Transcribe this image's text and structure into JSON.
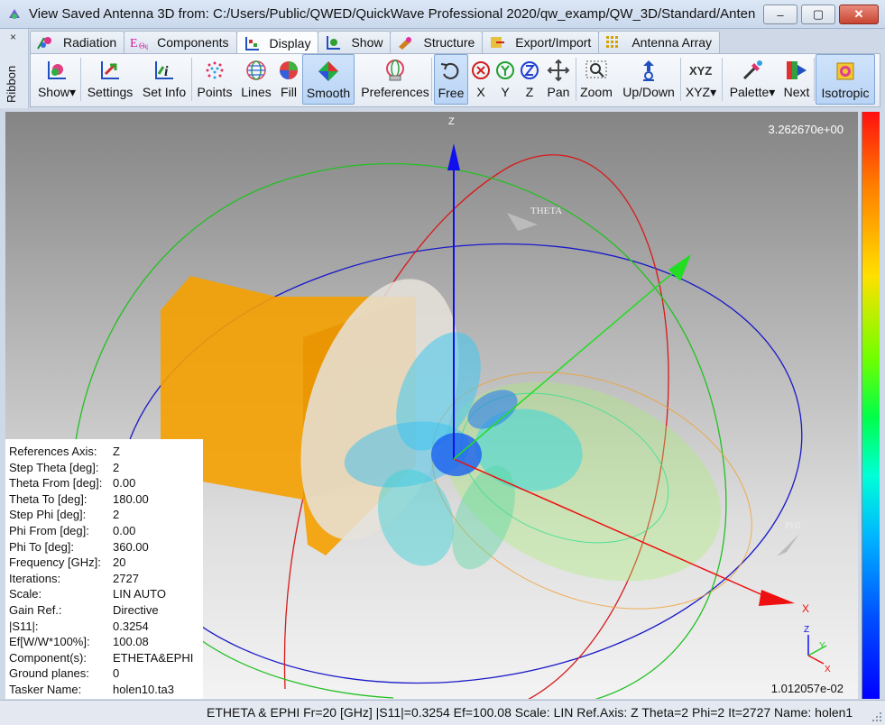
{
  "window": {
    "title": "View Saved Antenna 3D from: C:/Users/Public/QWED/QuickWave Professional 2020/qw_examp/QW_3D/Standard/Anten",
    "min_glyph": "–",
    "max_glyph": "▢",
    "close_glyph": "✕"
  },
  "sidestrip": {
    "close_glyph": "×",
    "label": "Ribbon"
  },
  "tabs": [
    {
      "label": "Radiation",
      "icon": "radiation-tab-icon"
    },
    {
      "label": "Components",
      "icon": "components-tab-icon"
    },
    {
      "label": "Display",
      "icon": "display-tab-icon",
      "active": true
    },
    {
      "label": "Show",
      "icon": "show-tab-icon"
    },
    {
      "label": "Structure",
      "icon": "structure-tab-icon"
    },
    {
      "label": "Export/Import",
      "icon": "export-import-tab-icon"
    },
    {
      "label": "Antenna Array",
      "icon": "antenna-array-tab-icon"
    }
  ],
  "ribbon": {
    "show": "Show",
    "settings": "Settings",
    "set_info": "Set Info",
    "points": "Points",
    "lines": "Lines",
    "fill": "Fill",
    "smooth": "Smooth",
    "preferences": "Preferences",
    "free": "Free",
    "x": "X",
    "y": "Y",
    "z": "Z",
    "pan": "Pan",
    "zoom": "Zoom",
    "up_down": "Up/Down",
    "xyz": "XYZ",
    "palette": "Palette",
    "next": "Next",
    "isotropic": "Isotropic",
    "xyz_icon_text": "XYZ"
  },
  "viewport": {
    "max_value": "3.262670e+00",
    "min_value": "1.012057e-02",
    "axis_z": "Z",
    "axis_x": "X",
    "axis_theta": "THETA",
    "axis_phi": "PHI",
    "mini_x": "X",
    "mini_y": "Y",
    "mini_z": "Z",
    "colors": {
      "horn": "#f5a000",
      "x_axis": "#ee1010",
      "y_axis": "#22dd22",
      "z_axis": "#1010ee"
    }
  },
  "info": [
    {
      "key": "References Axis:",
      "value": "Z"
    },
    {
      "key": "Step Theta [deg]:",
      "value": "2"
    },
    {
      "key": "Theta From [deg]:",
      "value": "0.00"
    },
    {
      "key": "Theta To [deg]:",
      "value": "180.00"
    },
    {
      "key": "Step Phi [deg]:",
      "value": "2"
    },
    {
      "key": "Phi From [deg]:",
      "value": "0.00"
    },
    {
      "key": "Phi To [deg]:",
      "value": "360.00"
    },
    {
      "key": "Frequency [GHz]:",
      "value": "20"
    },
    {
      "key": "Iterations:",
      "value": "2727"
    },
    {
      "key": "Scale:",
      "value": "LIN AUTO"
    },
    {
      "key": "Gain Ref.:",
      "value": "Directive"
    },
    {
      "key": "|S11|:",
      "value": "0.3254"
    },
    {
      "key": "Ef[W/W*100%]:",
      "value": "100.08"
    },
    {
      "key": "Component(s):",
      "value": "ETHETA&EPHI"
    },
    {
      "key": "Ground planes:",
      "value": "0"
    },
    {
      "key": "Tasker Name:",
      "value": "holen10.ta3"
    }
  ],
  "status": "ETHETA & EPHI Fr=20 [GHz] |S11|=0.3254 Ef=100.08 Scale: LIN Ref.Axis: Z Theta=2 Phi=2 It=2727 Name: holen1"
}
